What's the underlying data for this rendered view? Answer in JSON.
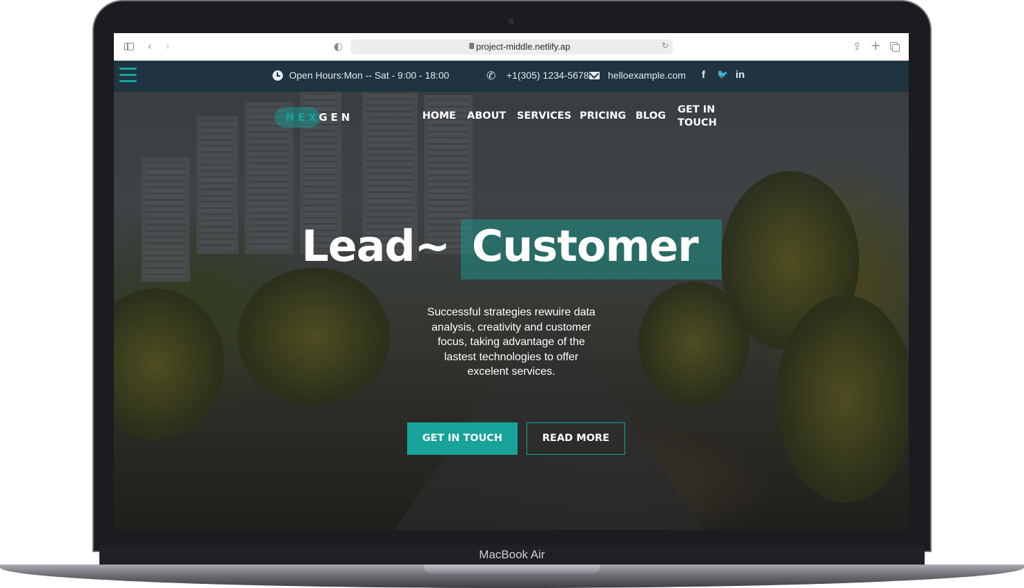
{
  "device": {
    "model_label": "MacBook Air"
  },
  "browser": {
    "url": "project-middle.netlify.ap",
    "icons": [
      "sidebar-toggle-icon",
      "back-icon",
      "forward-icon",
      "shield-icon",
      "lock-icon",
      "reload-icon",
      "share-icon",
      "new-tab-icon",
      "tabs-icon"
    ]
  },
  "topbar": {
    "hours": "Open Hours:Mon -- Sat - 9:00 - 18:00",
    "phone": "+1(305) 1234-5678",
    "email": "helloexample.com",
    "social": [
      "f",
      "🐦",
      "in"
    ]
  },
  "logo": {
    "part1": "NEX",
    "part2": "GEN"
  },
  "nav": {
    "items": [
      "HOME",
      "ABOUT",
      "SERVICES",
      "PRICING",
      "BLOG",
      "GET IN TOUCH"
    ]
  },
  "hero": {
    "headline_1": "Lead~",
    "headline_2": "Customer",
    "subtext": "Successful strategies rewuire data analysis, creativity and customer focus, taking advantage of the lastest technologies to offer excelent services.",
    "primary_button": "GET IN TOUCH",
    "secondary_button": "READ MORE"
  },
  "colors": {
    "accent": "#17a39a",
    "topbar_bg": "#1f3340"
  }
}
